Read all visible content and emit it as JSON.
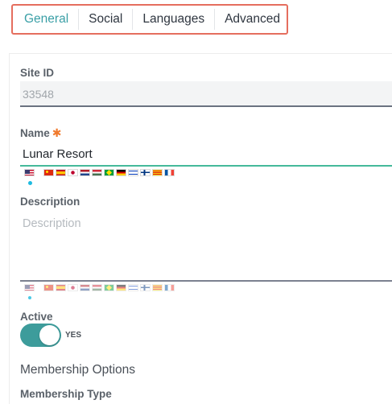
{
  "tabs": [
    {
      "label": "General",
      "active": true
    },
    {
      "label": "Social",
      "active": false
    },
    {
      "label": "Languages",
      "active": false
    },
    {
      "label": "Advanced",
      "active": false
    }
  ],
  "form": {
    "site_id": {
      "label": "Site ID",
      "value": "33548"
    },
    "name": {
      "label": "Name",
      "required_mark": "✱",
      "value": "Lunar Resort"
    },
    "description": {
      "label": "Description",
      "placeholder": "Description",
      "value": ""
    },
    "active": {
      "label": "Active",
      "toggle_on": true,
      "toggle_text": "YES"
    },
    "membership_options": {
      "heading": "Membership Options"
    },
    "membership_type": {
      "label": "Membership Type"
    }
  },
  "language_flags": [
    "us-flag-icon",
    "cn-flag-icon",
    "es-flag-icon",
    "jp-flag-icon",
    "nl-flag-icon",
    "hu-flag-icon",
    "br-flag-icon",
    "de-flag-icon",
    "il-flag-icon",
    "fi-flag-icon",
    "ca-flag-icon",
    "fr-flag-icon"
  ],
  "colors": {
    "accent": "#3a9fa6",
    "highlight_border": "#e56e5e",
    "required": "#f07a2d",
    "name_underline": "#45b99a",
    "toggle": "#3d9c9b",
    "selected_dot": "#1ebbe0"
  }
}
